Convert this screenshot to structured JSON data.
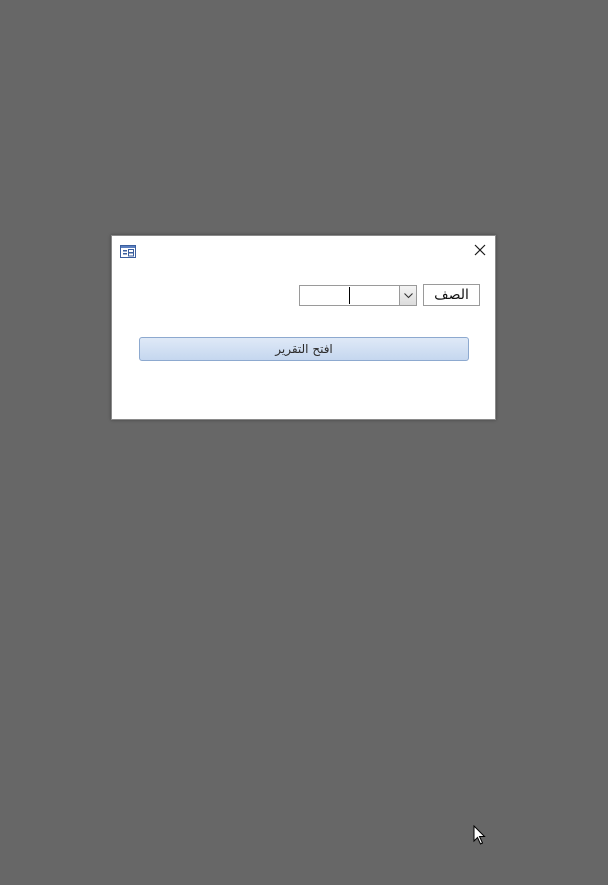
{
  "dialog": {
    "field_label": "الصف",
    "combo_value": "",
    "open_button_label": "افتح التقرير",
    "icons": {
      "form": "form-icon",
      "close": "close-icon",
      "dropdown": "chevron-down-icon",
      "pointer": "mouse-pointer-icon"
    }
  },
  "colors": {
    "desktop": "#676767",
    "dialog": "#ffffff",
    "button_top": "#dfe9f7",
    "button_bottom": "#c5d7ef",
    "button_border": "#8da9cf"
  }
}
